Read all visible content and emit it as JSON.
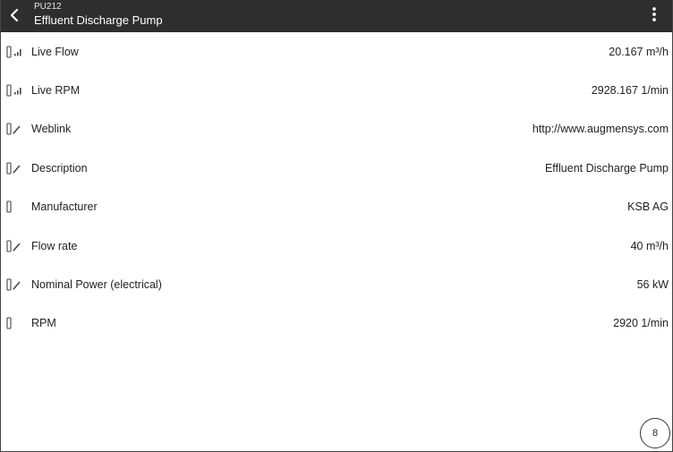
{
  "header": {
    "subtitle": "PU212",
    "title": "Effluent Discharge Pump"
  },
  "rows": [
    {
      "label": "Live Flow",
      "value": "20.167 m³/h",
      "icon": "live-signal-icon"
    },
    {
      "label": "Live RPM",
      "value": "2928.167 1/min",
      "icon": "live-signal-icon"
    },
    {
      "label": "Weblink",
      "value": "http://www.augmensys.com",
      "icon": "edit-icon"
    },
    {
      "label": "Description",
      "value": "Effluent Discharge Pump",
      "icon": "edit-icon"
    },
    {
      "label": "Manufacturer",
      "value": "KSB AG",
      "icon": "readonly-icon"
    },
    {
      "label": "Flow rate",
      "value": "40 m³/h",
      "icon": "edit-icon"
    },
    {
      "label": "Nominal Power (electrical)",
      "value": "56 kW",
      "icon": "edit-icon"
    },
    {
      "label": "RPM",
      "value": "2920 1/min",
      "icon": "readonly-icon"
    }
  ],
  "badge": {
    "count": "8"
  }
}
